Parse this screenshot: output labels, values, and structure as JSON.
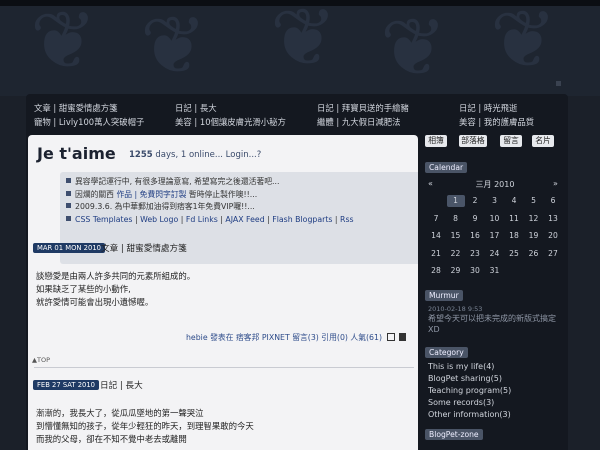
{
  "nav": {
    "col1": [
      "文章 | 甜蜜愛情處方箋",
      "寵物 | Livly100萬人突破帽子"
    ],
    "col2": [
      "日記 | 長大",
      "美容 | 10個讓皮膚光滑小秘方"
    ],
    "col3": [
      "日記 | 拜寶貝送的手繪豬",
      "繼體 | 九大假日減肥法"
    ],
    "col4": [
      "日記 | 時光飛逝",
      "美容 | 我的護膚品質"
    ]
  },
  "header": {
    "title": "Je t'aime",
    "stats_days": "1255",
    "stats_rest": "days, 1 online... Login...?"
  },
  "notice": {
    "line1": "異容學記運行中, 有很多理論意寫, 希望寫完之後還活著吧...",
    "line2_pre": "因爛的關西 ",
    "line2_link": "作品 | 免費閃字訂製",
    "line2_post": " 暫時停止製作噢!!...",
    "line3": "2009.3.6. 為中華郵加油得到痞客1年免費VIP囉!!...",
    "links": [
      "CSS Templates",
      "Web Logo",
      "Fd Links",
      "AJAX Feed",
      "Flash Blogparts",
      "Rss"
    ]
  },
  "post1": {
    "date": "MAR 01 MON 2010",
    "title": "文章 | 甜蜜愛情處方箋",
    "body": [
      "談戀愛是由兩人許多共同的元素所組成的。",
      "如果缺乏了某些的小動作,",
      "就許愛情可能會出現小遺憾喔。"
    ],
    "footer": "hebie 發表在 痞客邦 PIXNET 留言(3) 引用(0) 人氣(61)",
    "totop": "▲TOP"
  },
  "post2": {
    "date": "FEB 27 SAT 2010",
    "title": "日記 | 長大",
    "body": [
      "漸漸的，我長大了，從瓜瓜墜地的第一聲哭泣",
      "到懵懂無知的孩子，從年少輕狂的昨天，到理智果敢的今天",
      "而我的父母，卻在不知不覺中老去或離開"
    ]
  },
  "sidebar": {
    "tabs": [
      "相簿",
      "部落格",
      "留言",
      "名片"
    ],
    "calendar_h": "Calendar",
    "month": "三月 2010",
    "prev": "«",
    "next": "»",
    "days": [
      [
        "",
        "1",
        "2",
        "3",
        "4",
        "5",
        "6"
      ],
      [
        "7",
        "8",
        "9",
        "10",
        "11",
        "12",
        "13"
      ],
      [
        "14",
        "15",
        "16",
        "17",
        "18",
        "19",
        "20"
      ],
      [
        "21",
        "22",
        "23",
        "24",
        "25",
        "26",
        "27"
      ],
      [
        "28",
        "29",
        "30",
        "31",
        "",
        "",
        ""
      ]
    ],
    "murmur_h": "Murmur",
    "murmur_meta": "2010-02-18 9:53",
    "murmur_text": "希望今天可以把未完成的新版式搞定XD",
    "category_h": "Category",
    "categories": [
      "This is my life(4)",
      "BlogPet sharing(5)",
      "Teaching program(5)",
      "Some records(3)",
      "Other information(3)"
    ],
    "blogpet_h": "BlogPet-zone"
  }
}
